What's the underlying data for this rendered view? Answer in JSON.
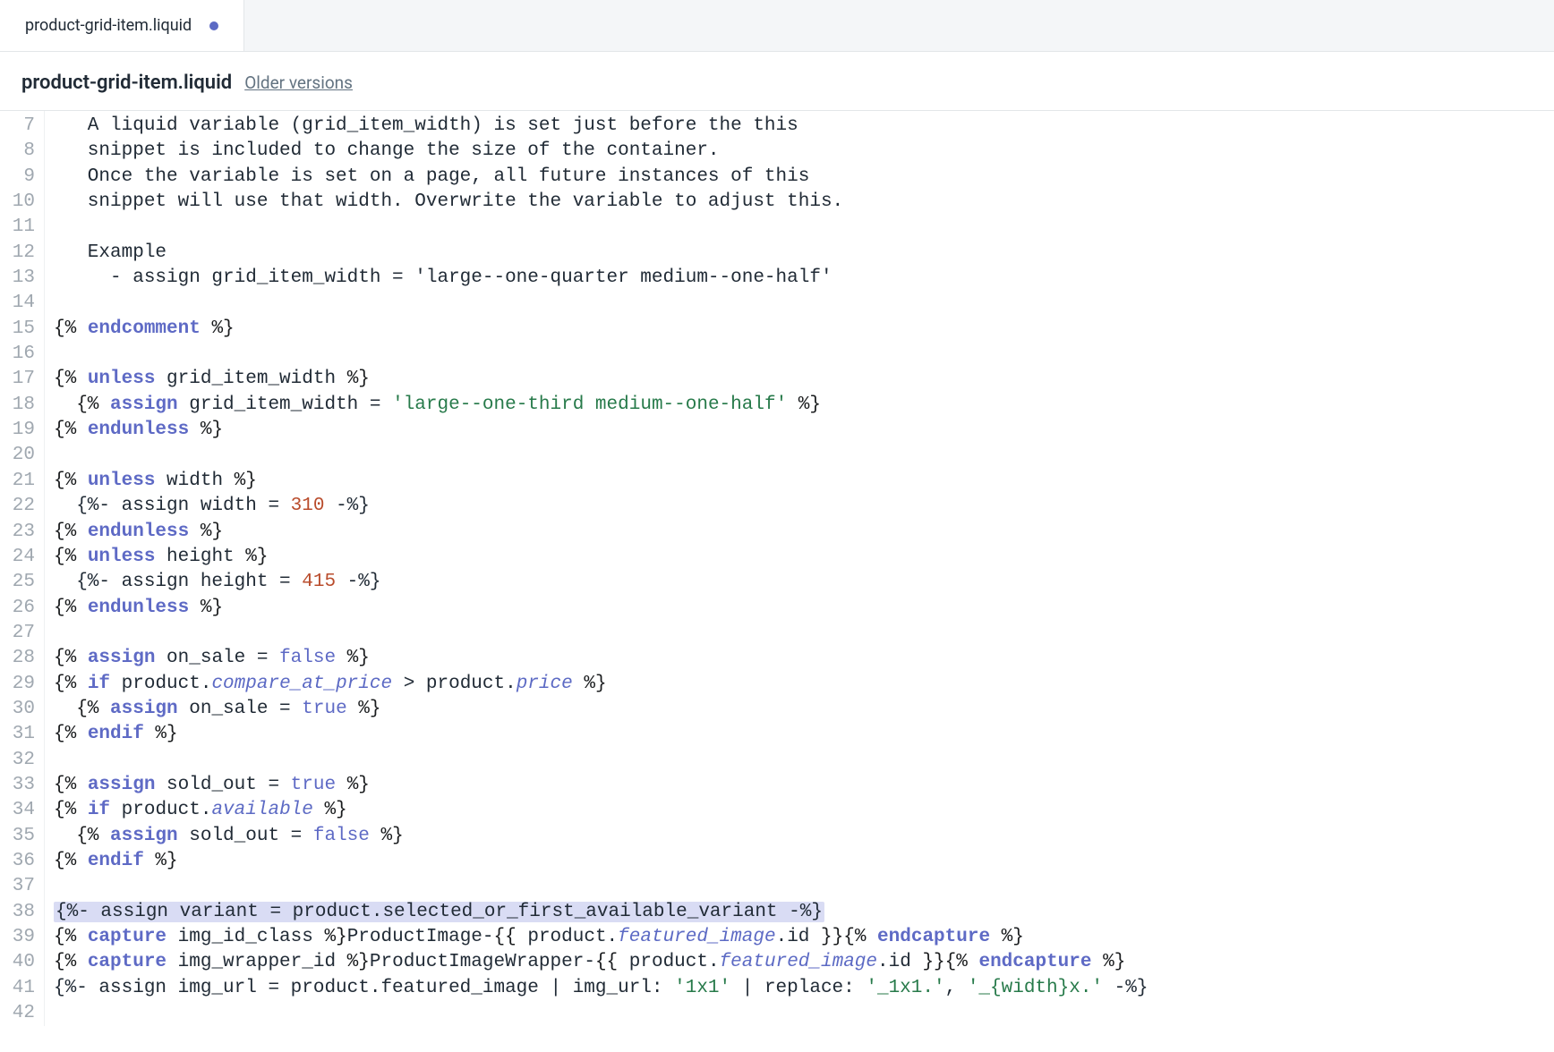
{
  "tab": {
    "label": "product-grid-item.liquid",
    "modified": true
  },
  "header": {
    "title": "product-grid-item.liquid",
    "older_versions_label": "Older versions"
  },
  "gutter": {
    "start": 7,
    "end": 42
  },
  "code": {
    "lines": [
      {
        "n": 7,
        "segs": [
          {
            "t": "   A liquid variable (grid_item_width) is set just before the this",
            "c": "c-text"
          }
        ]
      },
      {
        "n": 8,
        "segs": [
          {
            "t": "   snippet is included to change the size of the container.",
            "c": "c-text"
          }
        ]
      },
      {
        "n": 9,
        "segs": [
          {
            "t": "   Once the variable is set on a page, all future instances of this",
            "c": "c-text"
          }
        ]
      },
      {
        "n": 10,
        "segs": [
          {
            "t": "   snippet will use that width. Overwrite the variable to adjust this.",
            "c": "c-text"
          }
        ]
      },
      {
        "n": 11,
        "segs": [
          {
            "t": "",
            "c": "c-text"
          }
        ]
      },
      {
        "n": 12,
        "segs": [
          {
            "t": "   Example",
            "c": "c-text"
          }
        ]
      },
      {
        "n": 13,
        "segs": [
          {
            "t": "     - assign grid_item_width = 'large--one-quarter medium--one-half'",
            "c": "c-text"
          }
        ]
      },
      {
        "n": 14,
        "segs": [
          {
            "t": "",
            "c": "c-text"
          }
        ]
      },
      {
        "n": 15,
        "segs": [
          {
            "t": "{% ",
            "c": "c-delim"
          },
          {
            "t": "endcomment",
            "c": "c-kw"
          },
          {
            "t": " %}",
            "c": "c-delim"
          }
        ]
      },
      {
        "n": 16,
        "segs": [
          {
            "t": "",
            "c": "c-text"
          }
        ]
      },
      {
        "n": 17,
        "segs": [
          {
            "t": "{% ",
            "c": "c-delim"
          },
          {
            "t": "unless",
            "c": "c-kw"
          },
          {
            "t": " grid_item_width ",
            "c": "c-text"
          },
          {
            "t": "%}",
            "c": "c-delim"
          }
        ]
      },
      {
        "n": 18,
        "segs": [
          {
            "t": "  {% ",
            "c": "c-delim"
          },
          {
            "t": "assign",
            "c": "c-kw"
          },
          {
            "t": " grid_item_width = ",
            "c": "c-text"
          },
          {
            "t": "'large--one-third medium--one-half'",
            "c": "c-str"
          },
          {
            "t": " %}",
            "c": "c-delim"
          }
        ]
      },
      {
        "n": 19,
        "segs": [
          {
            "t": "{% ",
            "c": "c-delim"
          },
          {
            "t": "endunless",
            "c": "c-kw"
          },
          {
            "t": " %}",
            "c": "c-delim"
          }
        ]
      },
      {
        "n": 20,
        "segs": [
          {
            "t": "",
            "c": "c-text"
          }
        ]
      },
      {
        "n": 21,
        "segs": [
          {
            "t": "{% ",
            "c": "c-delim"
          },
          {
            "t": "unless",
            "c": "c-kw"
          },
          {
            "t": " width ",
            "c": "c-text"
          },
          {
            "t": "%}",
            "c": "c-delim"
          }
        ]
      },
      {
        "n": 22,
        "segs": [
          {
            "t": "  {%- assign width = ",
            "c": "c-text"
          },
          {
            "t": "310",
            "c": "c-num"
          },
          {
            "t": " -%}",
            "c": "c-text"
          }
        ]
      },
      {
        "n": 23,
        "segs": [
          {
            "t": "{% ",
            "c": "c-delim"
          },
          {
            "t": "endunless",
            "c": "c-kw"
          },
          {
            "t": " %}",
            "c": "c-delim"
          }
        ]
      },
      {
        "n": 24,
        "segs": [
          {
            "t": "{% ",
            "c": "c-delim"
          },
          {
            "t": "unless",
            "c": "c-kw"
          },
          {
            "t": " height ",
            "c": "c-text"
          },
          {
            "t": "%}",
            "c": "c-delim"
          }
        ]
      },
      {
        "n": 25,
        "segs": [
          {
            "t": "  {%- assign height = ",
            "c": "c-text"
          },
          {
            "t": "415",
            "c": "c-num"
          },
          {
            "t": " -%}",
            "c": "c-text"
          }
        ]
      },
      {
        "n": 26,
        "segs": [
          {
            "t": "{% ",
            "c": "c-delim"
          },
          {
            "t": "endunless",
            "c": "c-kw"
          },
          {
            "t": " %}",
            "c": "c-delim"
          }
        ]
      },
      {
        "n": 27,
        "segs": [
          {
            "t": "",
            "c": "c-text"
          }
        ]
      },
      {
        "n": 28,
        "segs": [
          {
            "t": "{% ",
            "c": "c-delim"
          },
          {
            "t": "assign",
            "c": "c-kw"
          },
          {
            "t": " on_sale = ",
            "c": "c-text"
          },
          {
            "t": "false",
            "c": "c-kw-nb"
          },
          {
            "t": " %}",
            "c": "c-delim"
          }
        ]
      },
      {
        "n": 29,
        "segs": [
          {
            "t": "{% ",
            "c": "c-delim"
          },
          {
            "t": "if",
            "c": "c-kw"
          },
          {
            "t": " product.",
            "c": "c-text"
          },
          {
            "t": "compare_at_price",
            "c": "c-prop"
          },
          {
            "t": " > product.",
            "c": "c-text"
          },
          {
            "t": "price",
            "c": "c-prop"
          },
          {
            "t": " %}",
            "c": "c-delim"
          }
        ]
      },
      {
        "n": 30,
        "segs": [
          {
            "t": "  {% ",
            "c": "c-delim"
          },
          {
            "t": "assign",
            "c": "c-kw"
          },
          {
            "t": " on_sale = ",
            "c": "c-text"
          },
          {
            "t": "true",
            "c": "c-kw-nb"
          },
          {
            "t": " %}",
            "c": "c-delim"
          }
        ]
      },
      {
        "n": 31,
        "segs": [
          {
            "t": "{% ",
            "c": "c-delim"
          },
          {
            "t": "endif",
            "c": "c-kw"
          },
          {
            "t": " %}",
            "c": "c-delim"
          }
        ]
      },
      {
        "n": 32,
        "segs": [
          {
            "t": "",
            "c": "c-text"
          }
        ]
      },
      {
        "n": 33,
        "segs": [
          {
            "t": "{% ",
            "c": "c-delim"
          },
          {
            "t": "assign",
            "c": "c-kw"
          },
          {
            "t": " sold_out = ",
            "c": "c-text"
          },
          {
            "t": "true",
            "c": "c-kw-nb"
          },
          {
            "t": " %}",
            "c": "c-delim"
          }
        ]
      },
      {
        "n": 34,
        "segs": [
          {
            "t": "{% ",
            "c": "c-delim"
          },
          {
            "t": "if",
            "c": "c-kw"
          },
          {
            "t": " product.",
            "c": "c-text"
          },
          {
            "t": "available",
            "c": "c-prop"
          },
          {
            "t": " %}",
            "c": "c-delim"
          }
        ]
      },
      {
        "n": 35,
        "segs": [
          {
            "t": "  {% ",
            "c": "c-delim"
          },
          {
            "t": "assign",
            "c": "c-kw"
          },
          {
            "t": " sold_out = ",
            "c": "c-text"
          },
          {
            "t": "false",
            "c": "c-kw-nb"
          },
          {
            "t": " %}",
            "c": "c-delim"
          }
        ]
      },
      {
        "n": 36,
        "segs": [
          {
            "t": "{% ",
            "c": "c-delim"
          },
          {
            "t": "endif",
            "c": "c-kw"
          },
          {
            "t": " %}",
            "c": "c-delim"
          }
        ]
      },
      {
        "n": 37,
        "segs": [
          {
            "t": "",
            "c": "c-text"
          }
        ]
      },
      {
        "n": 38,
        "hl": true,
        "segs": [
          {
            "t": "{%- assign variant = product.selected_or_first_available_variant -%}",
            "c": "c-text"
          }
        ]
      },
      {
        "n": 39,
        "segs": [
          {
            "t": "{% ",
            "c": "c-delim"
          },
          {
            "t": "capture",
            "c": "c-kw"
          },
          {
            "t": " img_id_class ",
            "c": "c-text"
          },
          {
            "t": "%}",
            "c": "c-delim"
          },
          {
            "t": "ProductImage-",
            "c": "c-text"
          },
          {
            "t": "{{",
            "c": "c-delim"
          },
          {
            "t": " product.",
            "c": "c-text"
          },
          {
            "t": "featured_image",
            "c": "c-prop"
          },
          {
            "t": ".id ",
            "c": "c-text"
          },
          {
            "t": "}}",
            "c": "c-delim"
          },
          {
            "t": "{% ",
            "c": "c-delim"
          },
          {
            "t": "endcapture",
            "c": "c-kw"
          },
          {
            "t": " %}",
            "c": "c-delim"
          }
        ]
      },
      {
        "n": 40,
        "segs": [
          {
            "t": "{% ",
            "c": "c-delim"
          },
          {
            "t": "capture",
            "c": "c-kw"
          },
          {
            "t": " img_wrapper_id ",
            "c": "c-text"
          },
          {
            "t": "%}",
            "c": "c-delim"
          },
          {
            "t": "ProductImageWrapper-",
            "c": "c-text"
          },
          {
            "t": "{{",
            "c": "c-delim"
          },
          {
            "t": " product.",
            "c": "c-text"
          },
          {
            "t": "featured_image",
            "c": "c-prop"
          },
          {
            "t": ".id ",
            "c": "c-text"
          },
          {
            "t": "}}",
            "c": "c-delim"
          },
          {
            "t": "{% ",
            "c": "c-delim"
          },
          {
            "t": "endcapture",
            "c": "c-kw"
          },
          {
            "t": " %}",
            "c": "c-delim"
          }
        ]
      },
      {
        "n": 41,
        "segs": [
          {
            "t": "{%- assign img_url = product.featured_image | img_url: ",
            "c": "c-text"
          },
          {
            "t": "'1x1'",
            "c": "c-str"
          },
          {
            "t": " | replace: ",
            "c": "c-text"
          },
          {
            "t": "'_1x1.'",
            "c": "c-str"
          },
          {
            "t": ", ",
            "c": "c-text"
          },
          {
            "t": "'_{width}x.'",
            "c": "c-str"
          },
          {
            "t": " -%}",
            "c": "c-text"
          }
        ]
      },
      {
        "n": 42,
        "segs": [
          {
            "t": "",
            "c": "c-text"
          }
        ]
      }
    ]
  }
}
